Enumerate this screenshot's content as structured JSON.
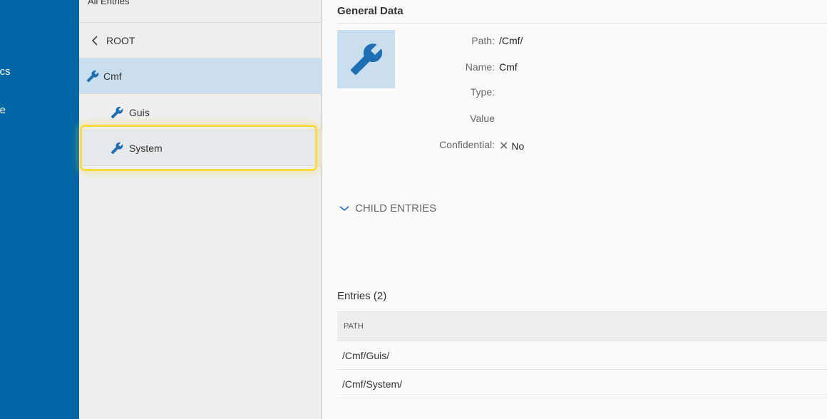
{
  "nav": {
    "items": [
      {
        "label": "tics"
      },
      {
        "label": "ce"
      }
    ]
  },
  "tree": {
    "header": "All Entries",
    "back_label": "ROOT",
    "selected": "Cmf",
    "children": [
      "Guis",
      "System"
    ]
  },
  "details": {
    "section_title": "General Data",
    "icon": "wrench-icon",
    "fields": {
      "path": {
        "label": "Path:",
        "value": "/Cmf/"
      },
      "name": {
        "label": "Name:",
        "value": "Cmf"
      },
      "type": {
        "label": "Type:",
        "value": ""
      },
      "value": {
        "label": "Value",
        "value": ""
      },
      "confidential": {
        "label": "Confidential:",
        "value": "No"
      }
    },
    "child_entries_label": "CHILD ENTRIES"
  },
  "entries": {
    "title": "Entries (2)",
    "column_header": "PATH",
    "rows": [
      "/Cmf/Guis/",
      "/Cmf/System/"
    ]
  },
  "colors": {
    "nav_bg": "#0067a5",
    "accent": "#1f6fb5",
    "selected_row": "#c9deef",
    "highlight_border": "#f7dc45"
  }
}
